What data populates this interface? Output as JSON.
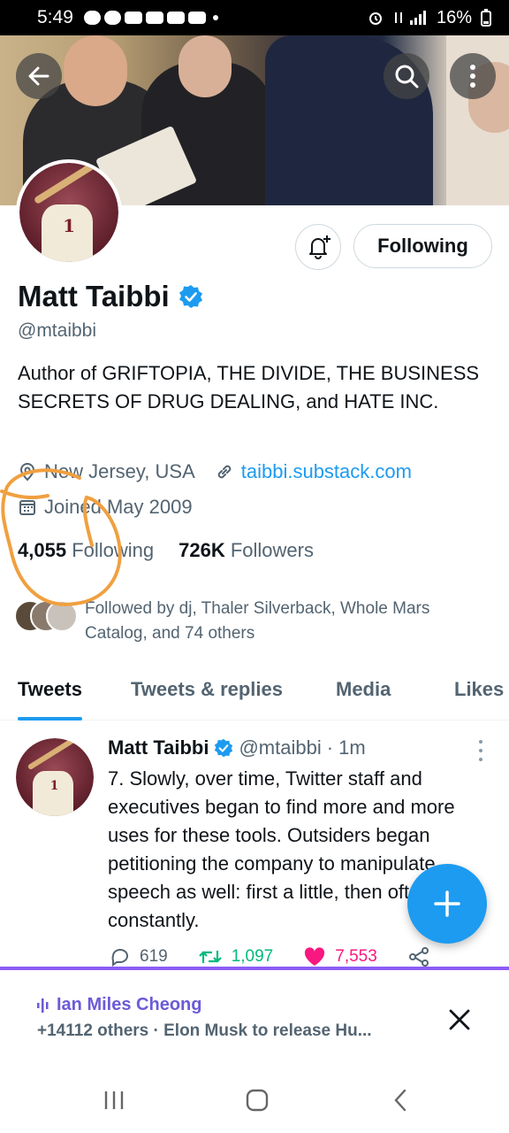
{
  "status_bar": {
    "time": "5:49",
    "battery": "16%"
  },
  "profile": {
    "name": "Matt Taibbi",
    "handle": "@mtaibbi",
    "bio": "Author of GRIFTOPIA, THE DIVIDE, THE BUSINESS SECRETS OF DRUG DEALING, and HATE INC.",
    "location": "New Jersey, USA",
    "website": "taibbi.substack.com",
    "joined": "Joined May 2009",
    "following_count": "4,055",
    "following_label": "Following",
    "followers_count": "726K",
    "followers_label": "Followers",
    "followed_by": "Followed by dj, Thaler Silverback, Whole Mars Catalog, and 74 others"
  },
  "actions": {
    "follow_button": "Following"
  },
  "tabs": [
    {
      "label": "Tweets",
      "active": true
    },
    {
      "label": "Tweets & replies",
      "active": false
    },
    {
      "label": "Media",
      "active": false
    },
    {
      "label": "Likes",
      "active": false
    }
  ],
  "tweet": {
    "author": "Matt Taibbi",
    "handle": "@mtaibbi",
    "time": "· 1m",
    "text": "7. Slowly, over time, Twitter staff and executives began to find more and more uses for these tools. Outsiders began petitioning the company to manipulate speech as well: first a little, then often, then constantly.",
    "replies": "619",
    "retweets": "1,097",
    "likes": "7,553"
  },
  "spaces": {
    "host": "Ian Miles Cheong",
    "subtitle": "+14112 others · Elon Musk to release Hu..."
  },
  "colors": {
    "accent": "#1d9bf0",
    "retweet": "#00ba7c",
    "like": "#f91880",
    "spaces": "#8b5cf6",
    "annotation": "#f0a040"
  },
  "icons": [
    "back-arrow-icon",
    "search-icon",
    "more-vertical-icon",
    "bell-plus-icon",
    "verified-badge-icon",
    "location-pin-icon",
    "link-icon",
    "calendar-icon",
    "reply-icon",
    "retweet-icon",
    "heart-icon",
    "share-icon",
    "plus-icon",
    "close-icon",
    "spaces-audio-icon"
  ]
}
